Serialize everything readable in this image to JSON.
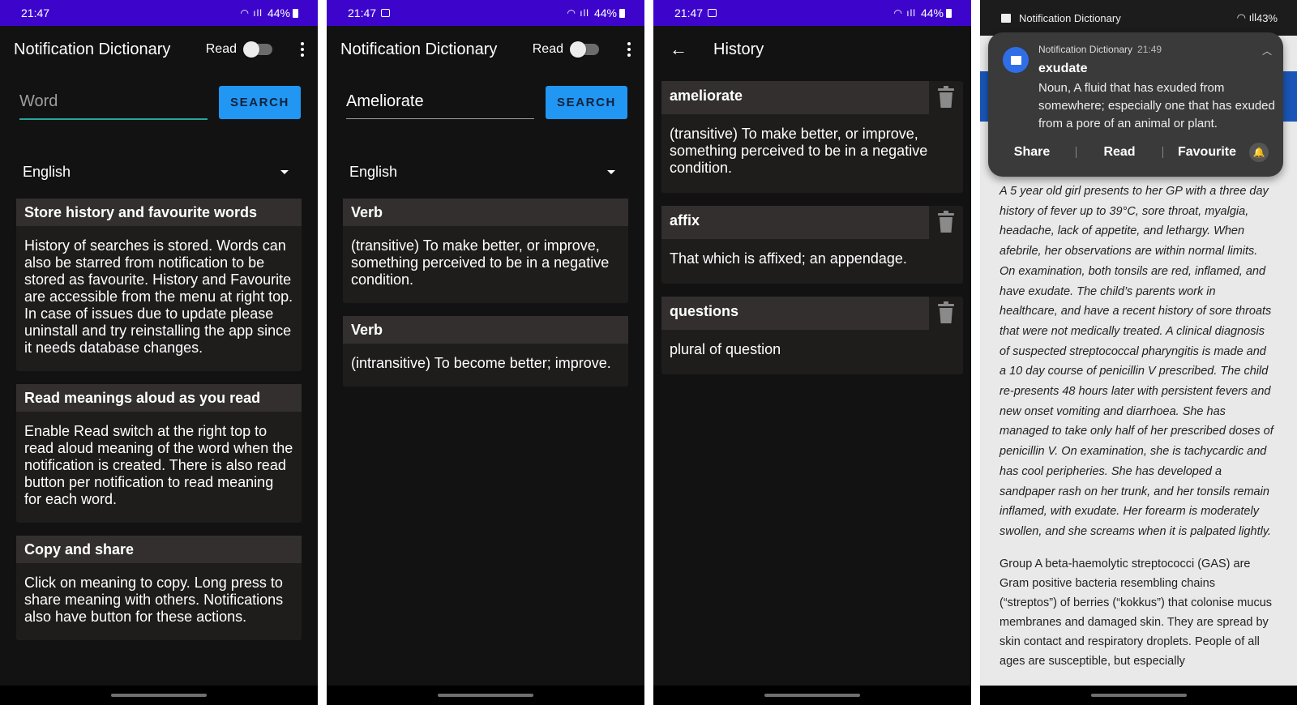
{
  "app": {
    "title": "Notification Dictionary",
    "read_label": "Read",
    "search_label": "SEARCH"
  },
  "p1": {
    "status": {
      "time": "21:47",
      "battery": "44%"
    },
    "search_placeholder": "Word",
    "language": "English",
    "cards": [
      {
        "title": "Store history and favourite words",
        "body": "History of searches is stored. Words can also be starred from notification to be stored as favourite. History and Favourite are accessible from the menu at right top. In case of issues due to update please uninstall and try reinstalling the app since it needs database changes."
      },
      {
        "title": "Read meanings aloud as you read",
        "body": "Enable Read switch at the right top to read aloud meaning of the word when the notification is created. There is also read button per notification to read meaning for each word."
      },
      {
        "title": "Copy and share",
        "body": "Click on meaning to copy. Long press to share meaning with others. Notifications also have button for these actions."
      }
    ]
  },
  "p2": {
    "status": {
      "time": "21:47",
      "battery": "44%"
    },
    "search_value": "Ameliorate",
    "language": "English",
    "cards": [
      {
        "title": "Verb",
        "body": "(transitive) To make better, or improve, something perceived to be in a negative condition."
      },
      {
        "title": "Verb",
        "body": "(intransitive) To become better; improve."
      }
    ]
  },
  "p3": {
    "status": {
      "time": "21:47",
      "battery": "44%"
    },
    "title": "History",
    "items": [
      {
        "word": "ameliorate",
        "meaning": "(transitive) To make better, or improve, something perceived to be in a negative condition."
      },
      {
        "word": "affix",
        "meaning": "That which is affixed; an appendage."
      },
      {
        "word": "questions",
        "meaning": "plural of question"
      }
    ]
  },
  "p4": {
    "status": {
      "label": "Notification Dictionary",
      "battery": "43%"
    },
    "notification": {
      "app": "Notification Dictionary",
      "time": "21:49",
      "word": "exudate",
      "definition": "Noun, A fluid that has exuded from somewhere; especially one that has exuded from a pore of an animal or plant.",
      "actions": [
        "Share",
        "Read",
        "Favourite"
      ]
    },
    "article": {
      "p1": "A 5 year old girl presents to her GP with a three day history of fever up to 39°C, sore throat, myalgia, headache, lack of appetite, and lethargy. When afebrile, her observations are within normal limits. On examination, both tonsils are red, inflamed, and have exudate. The child’s parents work in healthcare, and have a recent history of sore throats that were not medically treated. A clinical diagnosis of suspected streptococcal pharyngitis is made and a 10 day course of penicillin V prescribed. The child re-presents 48 hours later with persistent fevers and new onset vomiting and diarrhoea. She has managed to take only half of her prescribed doses of penicillin V. On examination, she is tachycardic and has cool peripheries. She has developed a sandpaper rash on her trunk, and her tonsils remain inflamed, with exudate. Her forearm is moderately swollen, and she screams when it is palpated lightly.",
      "p2": "Group A beta-haemolytic streptococci (GAS) are Gram positive bacteria resembling chains (“streptos”) of berries (“kokkus”) that colonise mucus membranes and damaged skin. They are spread by skin contact and respiratory droplets. People of all ages are susceptible, but especially"
    }
  }
}
